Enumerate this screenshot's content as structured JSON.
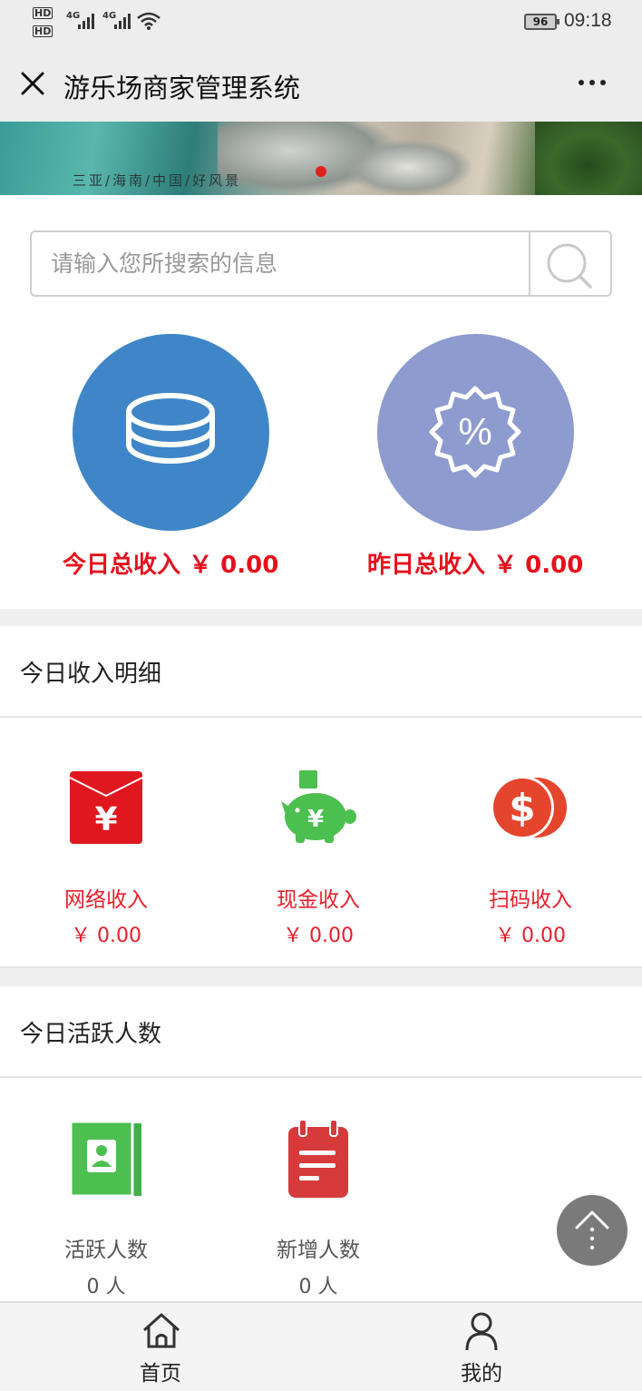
{
  "status_bar": {
    "network_1": "4G",
    "network_2": "4G",
    "battery": "96",
    "time": "09:18"
  },
  "nav": {
    "title": "游乐场商家管理系统"
  },
  "banner": {
    "caption": "三亚/海南/中国/好风景"
  },
  "search": {
    "placeholder": "请输入您所搜索的信息"
  },
  "summary": {
    "today_label": "今日总收入",
    "today_value": "￥ 0.00",
    "yesterday_label": "昨日总收入",
    "yesterday_value": "￥ 0.00",
    "today_color": "#3f86c8",
    "yesterday_color": "#8e9bcf"
  },
  "income_section": {
    "title": "今日收入明细",
    "items": [
      {
        "label": "网络收入",
        "value": "￥ 0.00",
        "icon": "red-envelope-icon"
      },
      {
        "label": "现金收入",
        "value": "￥ 0.00",
        "icon": "piggy-bank-icon"
      },
      {
        "label": "扫码收入",
        "value": "￥ 0.00",
        "icon": "dollar-coins-icon"
      }
    ]
  },
  "active_section": {
    "title": "今日活跃人数",
    "items": [
      {
        "label": "活跃人数",
        "value": "0 人",
        "icon": "contact-card-icon"
      },
      {
        "label": "新增人数",
        "value": "0 人",
        "icon": "notepad-icon"
      }
    ]
  },
  "tabbar": {
    "home_label": "首页",
    "mine_label": "我的"
  },
  "colors": {
    "accent_red": "#e6101d",
    "green_icon": "#4bbf4f",
    "red_icon": "#d63a3a"
  }
}
